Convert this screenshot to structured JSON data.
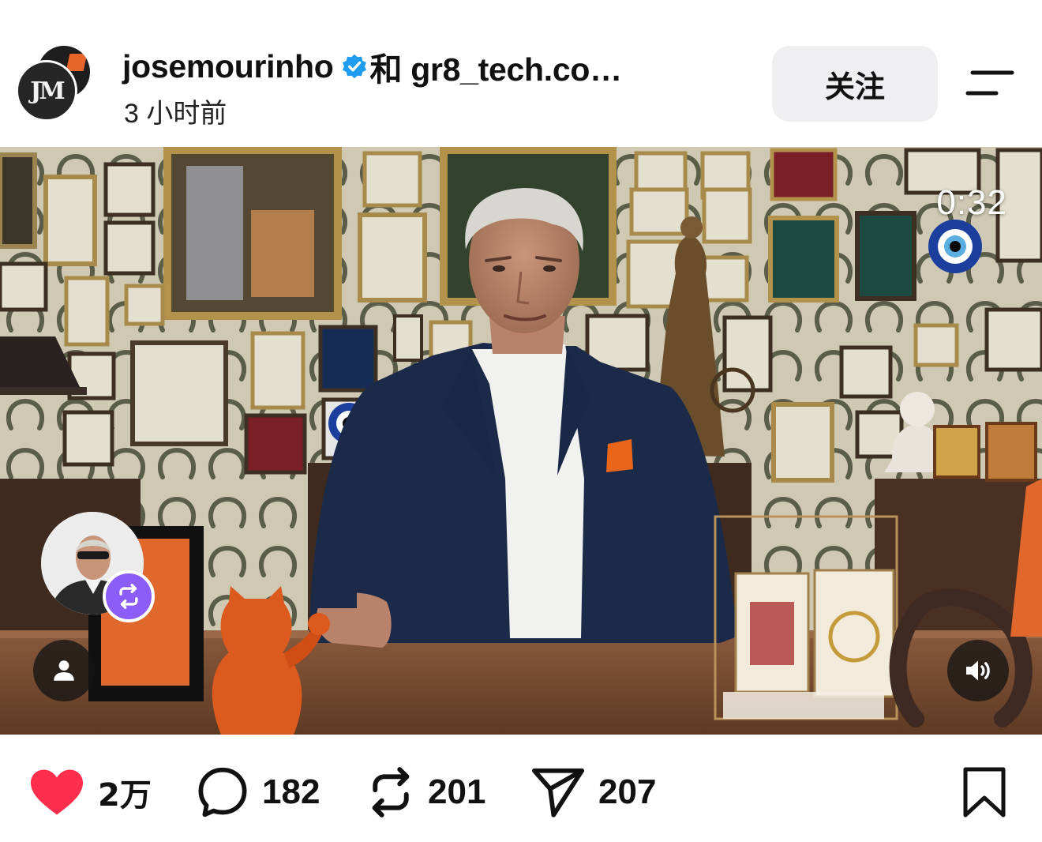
{
  "header": {
    "avatar_monogram": "JM",
    "username": "josemourinho",
    "collab_text": "和 gr8_tech.co…",
    "time_ago": "3 小时前",
    "follow_label": "关注"
  },
  "icons": {
    "avatar": "profile-avatar",
    "verified": "verified-badge-icon",
    "menu": "menu-icon",
    "user": "user-icon",
    "sound": "speaker-icon",
    "repost_badge": "repost-icon",
    "like": "heart-icon",
    "comment": "comment-icon",
    "repost": "repost-icon",
    "share": "send-icon",
    "bookmark": "bookmark-icon"
  },
  "video": {
    "duration": "0:32"
  },
  "actions": {
    "likes": "2万",
    "comments": "182",
    "reposts": "201",
    "shares": "207"
  },
  "colors": {
    "like_red": "#ff2e4c",
    "verified_blue": "#1f9bf0",
    "repost_purple": "#8b5cf6",
    "follow_bg": "#efeff2"
  }
}
